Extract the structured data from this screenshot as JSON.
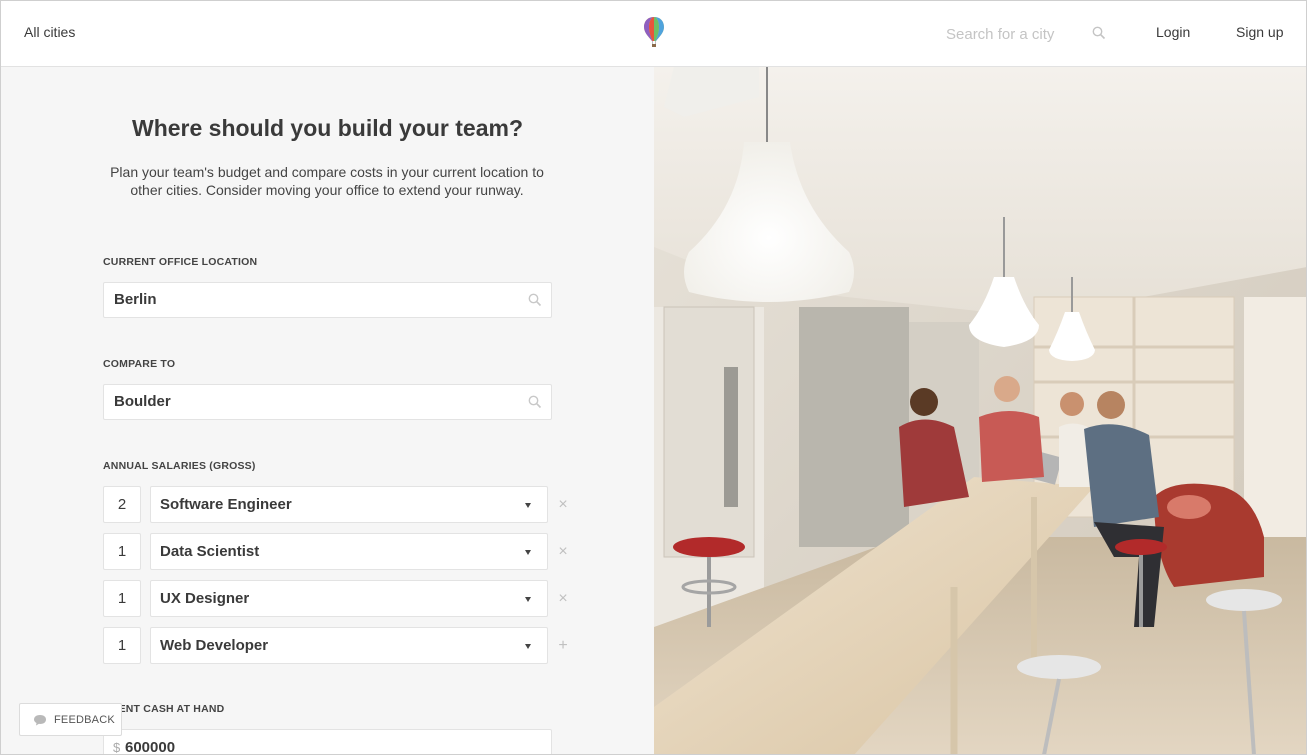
{
  "header": {
    "all_cities_label": "All cities",
    "search_placeholder": "Search for a city",
    "login_label": "Login",
    "signup_label": "Sign up"
  },
  "main": {
    "title": "Where should you build your team?",
    "intro": "Plan your team's budget and compare costs in your current location to other cities. Consider moving your office to extend your runway.",
    "current_office": {
      "label": "CURRENT OFFICE LOCATION",
      "value": "Berlin"
    },
    "compare_to": {
      "label": "COMPARE TO",
      "value": "Boulder"
    },
    "salaries": {
      "label": "ANNUAL SALARIES (GROSS)",
      "rows": [
        {
          "qty": "2",
          "role": "Software Engineer",
          "action": "remove"
        },
        {
          "qty": "1",
          "role": "Data Scientist",
          "action": "remove"
        },
        {
          "qty": "1",
          "role": "UX Designer",
          "action": "remove"
        },
        {
          "qty": "1",
          "role": "Web Developer",
          "action": "add"
        }
      ],
      "remove_glyph": "×",
      "add_glyph": "+"
    },
    "cash": {
      "label": "RRENT CASH AT HAND",
      "currency": "$",
      "value": "600000"
    }
  },
  "feedback": {
    "label": "FEEDBACK"
  },
  "colors": {
    "accent_text": "#3a3a3a",
    "panel_bg": "#f6f6f6",
    "muted": "#c0c0c0"
  },
  "icons": {
    "logo": "hot-air-balloon-icon",
    "search": "search-icon",
    "dropdown": "caret-down-icon",
    "feedback": "speech-bubble-icon"
  }
}
